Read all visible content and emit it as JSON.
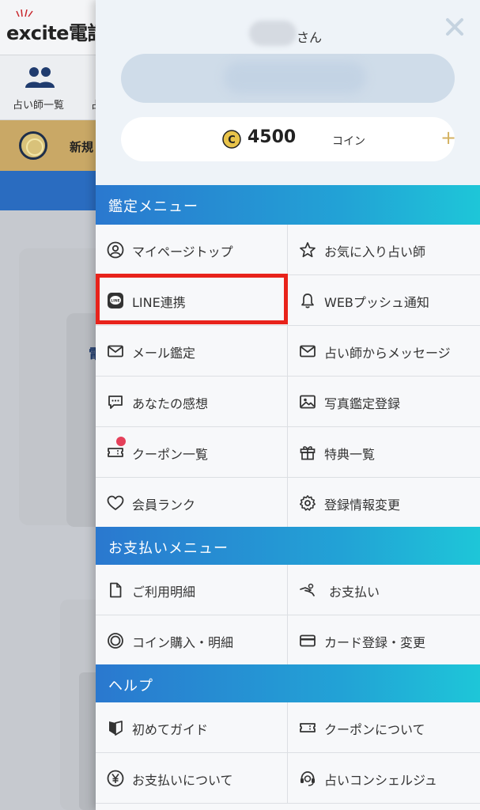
{
  "background": {
    "logo_text": "excite",
    "logo_suffix": "電話",
    "nav_label_1": "占い師一覧",
    "nav_label_2": "占",
    "banner_text": "新規",
    "card_text": "電"
  },
  "drawer": {
    "user_suffix": "さん",
    "coins": {
      "amount": "4500",
      "unit": "コイン",
      "symbol": "C"
    },
    "sections": [
      {
        "title": "鑑定メニュー",
        "items": [
          {
            "label": "マイページトップ",
            "icon": "user-circle-icon"
          },
          {
            "label": "お気に入り占い師",
            "icon": "star-icon"
          },
          {
            "label": "LINE連携",
            "icon": "line-icon"
          },
          {
            "label": "WEBプッシュ通知",
            "icon": "bell-icon"
          },
          {
            "label": "メール鑑定",
            "icon": "mail-icon"
          },
          {
            "label": "占い師からメッセージ",
            "icon": "mail-icon"
          },
          {
            "label": "あなたの感想",
            "icon": "comment-icon"
          },
          {
            "label": "写真鑑定登録",
            "icon": "photo-icon"
          },
          {
            "label": "クーポン一覧",
            "icon": "coupon-icon"
          },
          {
            "label": "特典一覧",
            "icon": "gift-icon"
          },
          {
            "label": "会員ランク",
            "icon": "heart-icon"
          },
          {
            "label": "登録情報変更",
            "icon": "gear-icon"
          }
        ]
      },
      {
        "title": "お支払いメニュー",
        "items": [
          {
            "label": "ご利用明細",
            "icon": "document-icon"
          },
          {
            "label": "お支払い",
            "icon": "hand-coin-icon"
          },
          {
            "label": "コイン購入・明細",
            "icon": "coin-ring-icon"
          },
          {
            "label": "カード登録・変更",
            "icon": "credit-card-icon"
          }
        ]
      },
      {
        "title": "ヘルプ",
        "items": [
          {
            "label": "初めてガイド",
            "icon": "beginner-mark-icon"
          },
          {
            "label": "クーポンについて",
            "icon": "ticket-icon"
          },
          {
            "label": "お支払いについて",
            "icon": "yen-circle-icon"
          },
          {
            "label": "占いコンシェルジュ",
            "icon": "headset-icon"
          }
        ]
      }
    ]
  },
  "colors": {
    "section_gradient_start": "#2a78cf",
    "section_gradient_end": "#1ec6d8",
    "highlight": "#e8231b",
    "coin_gold": "#d4b261",
    "notification_dot": "#e5405a"
  }
}
